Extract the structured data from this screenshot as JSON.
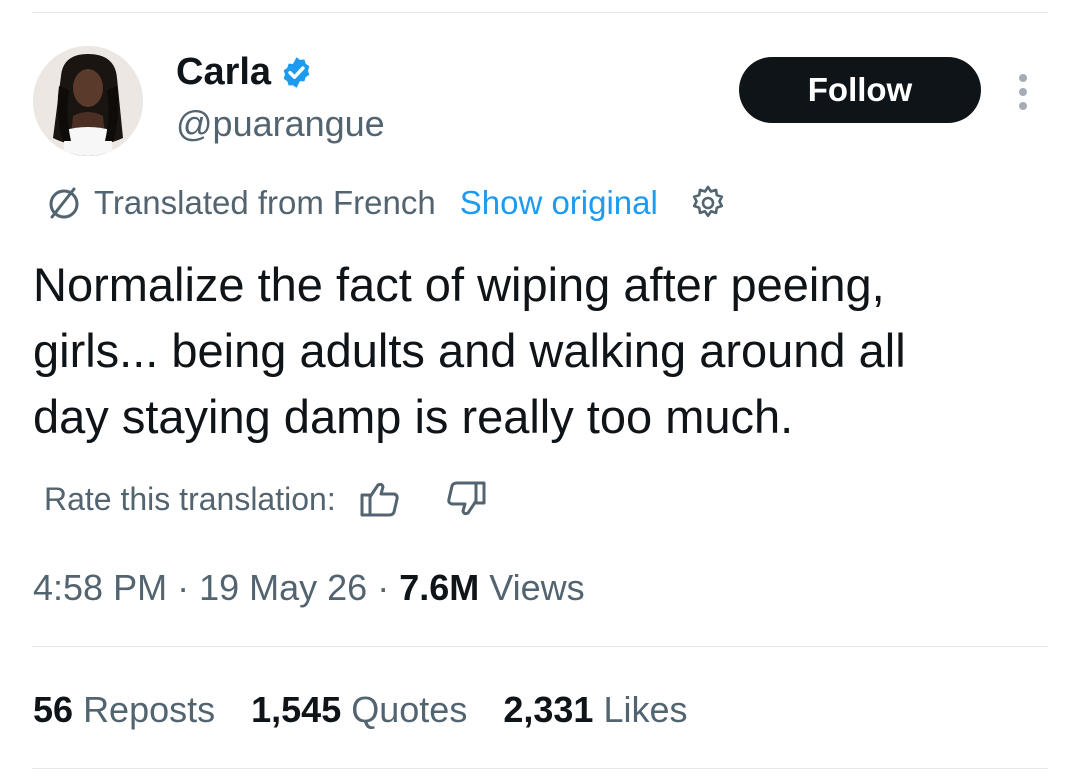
{
  "author": {
    "name": "Carla",
    "handle": "@puarangue",
    "verified": true,
    "avatar_icon": "profile-photo"
  },
  "follow_label": "Follow",
  "translation": {
    "note": "Translated from French",
    "show_original": "Show original"
  },
  "tweet_text": "Normalize the fact of wiping after peeing,\ngirls... being adults and walking around all\nday staying damp is really too much.",
  "rate": {
    "label": "Rate this translation:"
  },
  "meta": {
    "time": "4:58 PM",
    "date": "19 May 26",
    "views_count": "7.6M",
    "views_label": "Views"
  },
  "stats": {
    "reposts_count": "56",
    "reposts_label": "Reposts",
    "quotes_count": "1,545",
    "quotes_label": "Quotes",
    "likes_count": "2,331",
    "likes_label": "Likes"
  },
  "colors": {
    "accent": "#1d9bf0",
    "text_primary": "#0f1419",
    "text_secondary": "#536471",
    "follow_bg": "#0f1419"
  }
}
